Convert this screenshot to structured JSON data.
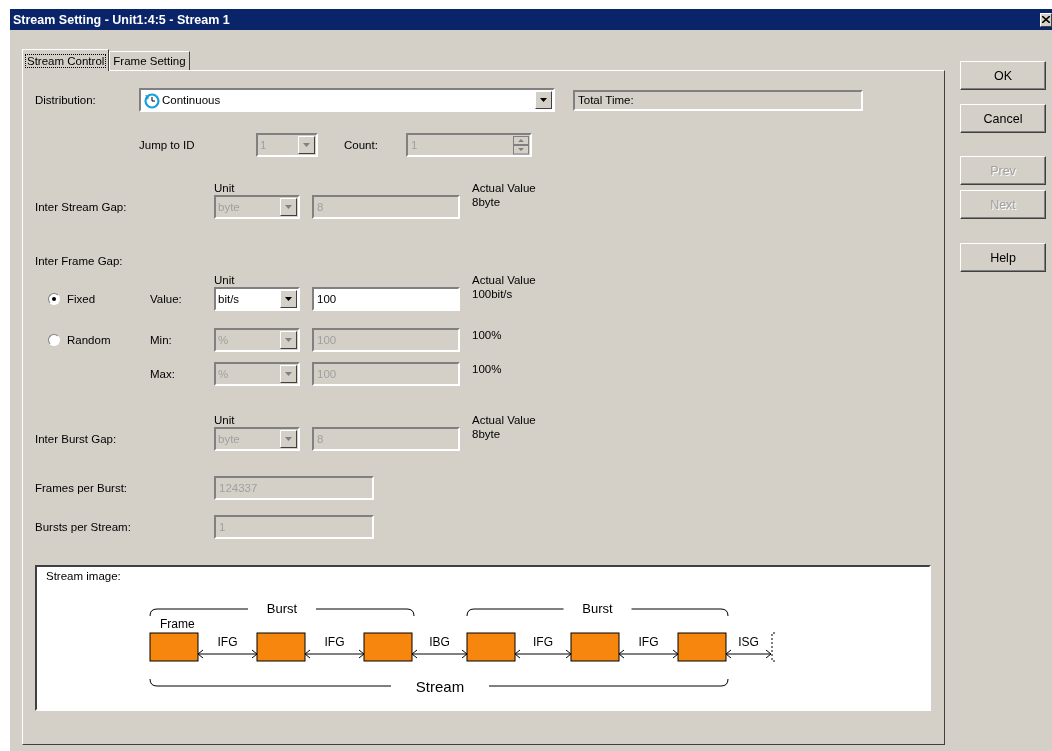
{
  "window": {
    "title": "Stream Setting - Unit1:4:5 - Stream 1"
  },
  "tabs": [
    {
      "label": "Stream Control",
      "selected": true
    },
    {
      "label": "Frame Setting",
      "selected": false
    }
  ],
  "distribution": {
    "label": "Distribution:",
    "value": "Continuous"
  },
  "total_time": {
    "value": "Total Time:"
  },
  "jump_to_id": {
    "label": "Jump to ID",
    "value": "1",
    "disabled": true
  },
  "count": {
    "label": "Count:",
    "value": "1",
    "disabled": true
  },
  "inter_stream_gap": {
    "label": "Inter Stream Gap:",
    "unit_label": "Unit",
    "unit": "byte",
    "value": "8",
    "disabled": true,
    "actual_label": "Actual Value",
    "actual": "8byte"
  },
  "inter_frame_gap": {
    "label": "Inter Frame Gap:",
    "unit_label": "Unit",
    "actual_label": "Actual Value",
    "modes": [
      {
        "label": "Fixed",
        "selected": true
      },
      {
        "label": "Random",
        "selected": false
      }
    ],
    "rows": [
      {
        "label": "Value:",
        "unit": "bit/s",
        "value": "100",
        "disabled": false,
        "actual": "100bit/s"
      },
      {
        "label": "Min:",
        "unit": "%",
        "value": "100",
        "disabled": true,
        "actual": "100%"
      },
      {
        "label": "Max:",
        "unit": "%",
        "value": "100",
        "disabled": true,
        "actual": "100%"
      }
    ]
  },
  "inter_burst_gap": {
    "label": "Inter Burst Gap:",
    "unit_label": "Unit",
    "unit": "byte",
    "value": "8",
    "disabled": true,
    "actual_label": "Actual Value",
    "actual": "8byte"
  },
  "frames_per_burst": {
    "label": "Frames per Burst:",
    "value": "124337",
    "disabled": true
  },
  "bursts_per_stream": {
    "label": "Bursts per Stream:",
    "value": "1",
    "disabled": true
  },
  "stream_image": {
    "title": "Stream image:",
    "burst_labels": [
      "Burst",
      "Burst"
    ],
    "frame_label": "Frame",
    "gaps": [
      "IFG",
      "IFG",
      "IBG",
      "IFG",
      "IFG",
      "ISG"
    ],
    "stream_label": "Stream"
  },
  "buttons": [
    {
      "label": "OK",
      "disabled": false
    },
    {
      "label": "Cancel",
      "disabled": false
    },
    {
      "label": "Prev",
      "disabled": true
    },
    {
      "label": "Next",
      "disabled": true
    },
    {
      "label": "Help",
      "disabled": false
    }
  ]
}
